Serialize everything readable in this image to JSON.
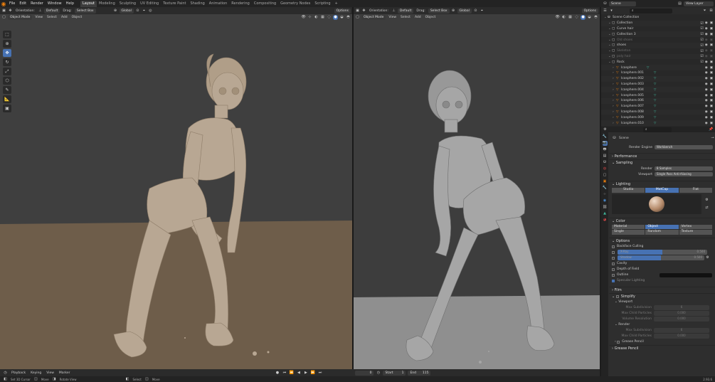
{
  "topbar": {
    "menus": [
      "File",
      "Edit",
      "Render",
      "Window",
      "Help"
    ],
    "workspaces": [
      "Layout",
      "Modeling",
      "Sculpting",
      "UV Editing",
      "Texture Paint",
      "Shading",
      "Animation",
      "Rendering",
      "Compositing",
      "Geometry Nodes",
      "Scripting"
    ],
    "active_workspace": "Layout",
    "add_tab": "+",
    "scene_label": "Scene",
    "view_layer_label": "View Layer"
  },
  "viewport_left": {
    "orientation": "Orientation:",
    "orientation_value": "Default",
    "drag_label": "Drag:",
    "drag_value": "Select Box",
    "transform_value": "Global",
    "options": "Options",
    "mode": "Object Mode",
    "menus": [
      "View",
      "Select",
      "Add",
      "Object"
    ]
  },
  "viewport_right": {
    "orientation": "Orientation:",
    "orientation_value": "Default",
    "drag_label": "Drag:",
    "drag_value": "Select Box",
    "transform_value": "Global",
    "options": "Options",
    "mode": "Object Mode",
    "menus": [
      "View",
      "Select",
      "Add",
      "Object"
    ]
  },
  "outliner": {
    "search_placeholder": "",
    "rows": [
      {
        "label": "Scene Collection",
        "indent": 0,
        "kind": "scene",
        "dim": false
      },
      {
        "label": "Collection",
        "indent": 1,
        "kind": "collection",
        "dim": false
      },
      {
        "label": "Curve hair",
        "indent": 1,
        "kind": "collection",
        "dim": false
      },
      {
        "label": "Collection 3",
        "indent": 1,
        "kind": "collection",
        "dim": false
      },
      {
        "label": "Old shoes",
        "indent": 1,
        "kind": "collection",
        "dim": true
      },
      {
        "label": "shoes",
        "indent": 1,
        "kind": "collection",
        "dim": false
      },
      {
        "label": "Skeleton",
        "indent": 1,
        "kind": "collection",
        "dim": true
      },
      {
        "label": "poly hair",
        "indent": 1,
        "kind": "collection",
        "dim": true
      },
      {
        "label": "Rock",
        "indent": 1,
        "kind": "collection",
        "dim": false
      },
      {
        "label": "Icosphere",
        "indent": 2,
        "kind": "mesh",
        "dim": false
      },
      {
        "label": "Icosphere.001",
        "indent": 2,
        "kind": "mesh",
        "dim": false
      },
      {
        "label": "Icosphere.002",
        "indent": 2,
        "kind": "mesh",
        "dim": false
      },
      {
        "label": "Icosphere.003",
        "indent": 2,
        "kind": "mesh",
        "dim": false
      },
      {
        "label": "Icosphere.004",
        "indent": 2,
        "kind": "mesh",
        "dim": false
      },
      {
        "label": "Icosphere.005",
        "indent": 2,
        "kind": "mesh",
        "dim": false
      },
      {
        "label": "Icosphere.006",
        "indent": 2,
        "kind": "mesh",
        "dim": false
      },
      {
        "label": "Icosphere.007",
        "indent": 2,
        "kind": "mesh",
        "dim": false
      },
      {
        "label": "Icosphere.008",
        "indent": 2,
        "kind": "mesh",
        "dim": false
      },
      {
        "label": "Icosphere.009",
        "indent": 2,
        "kind": "mesh",
        "dim": false
      },
      {
        "label": "Icosphere.010",
        "indent": 2,
        "kind": "mesh",
        "dim": false
      }
    ]
  },
  "properties": {
    "scene_name": "Scene",
    "render_engine_label": "Render Engine",
    "render_engine_value": "Workbench",
    "performance": "Performance",
    "sampling": "Sampling",
    "render_label": "Render",
    "render_value": "8 Samples",
    "viewport_label": "Viewport",
    "viewport_value": "Single Pass Anti-Aliasing",
    "lighting": "Lighting",
    "lighting_modes": [
      "Studio",
      "MatCap",
      "Flat"
    ],
    "lighting_selected": "MatCap",
    "color": "Color",
    "color_modes": [
      "Material",
      "Object",
      "Vertex",
      "Single",
      "Random",
      "Texture"
    ],
    "color_selected": "Object",
    "options": "Options",
    "backface_culling": "Backface Culling",
    "xray_label": "X-Ray",
    "xray_value": "0.500",
    "shadow_label": "Shadow",
    "shadow_value": "0.500",
    "cavity": "Cavity",
    "depth_of_field": "Depth of Field",
    "outline": "Outline",
    "specular": "Specular Lighting",
    "film": "Film",
    "simplify": "Simplify",
    "viewport_sub": "Viewport",
    "max_subdiv": "Max Subdivision",
    "max_child": "Max Child Particles",
    "volume_res": "Volume Resolution",
    "render_sub": "Render",
    "vp_max_subdiv_val": "6",
    "vp_max_child_val": "0.000",
    "vp_volume_val": "0.000",
    "r_max_subdiv_val": "6",
    "r_max_child_val": "0.000",
    "grease_pencil": "Grease Pencil",
    "grease_pencil2": "Grease Pencil"
  },
  "timeline": {
    "playback": "Playback",
    "keying": "Keying",
    "view": "View",
    "marker": "Marker",
    "current_frame": "0",
    "start_label": "Start",
    "start_value": "1",
    "end_label": "End",
    "end_value": "115"
  },
  "statusbar": {
    "items": [
      "Set 3D Cursor",
      "Move",
      "Rotate View",
      "Select",
      "Move"
    ],
    "version": "2.93.6"
  },
  "colors": {
    "accent": "#4772b3",
    "orange": "#e87d0d",
    "green": "#3fb59a",
    "left_floor": "#6e5d4a",
    "left_wall": "#3f3f3f",
    "right_floor": "#8f8f8f",
    "right_wall": "#3d3d3d"
  }
}
